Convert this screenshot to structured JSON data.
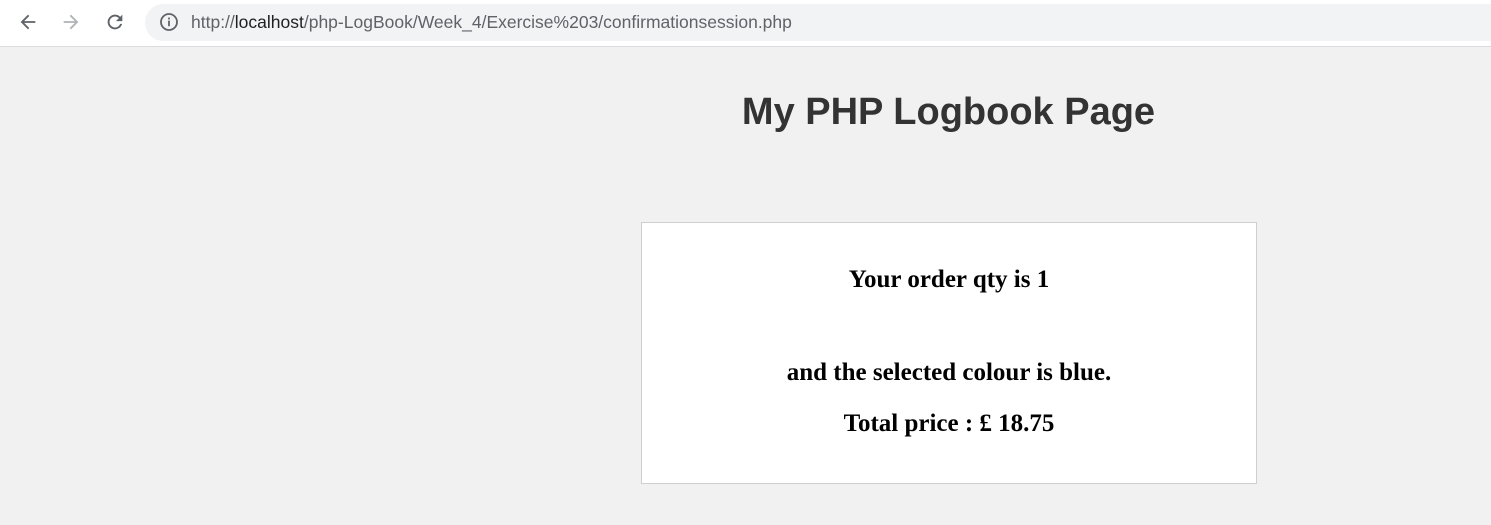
{
  "browser": {
    "url_scheme": "http://",
    "url_host": "localhost",
    "url_path": "/php-LogBook/Week_4/Exercise%203/confirmationsession.php",
    "icons": {
      "back": "arrow-left-icon",
      "forward": "arrow-right-icon",
      "reload": "reload-icon",
      "site_info": "info-icon"
    }
  },
  "page": {
    "title": "My PHP Logbook Page",
    "order": {
      "qty_line": "Your order qty is 1",
      "colour_line": "and the selected colour is blue.",
      "price_line": "Total price : £ 18.75"
    }
  },
  "colors": {
    "page_background": "#f1f1f1",
    "title_text": "#333333",
    "card_background": "#ffffff",
    "card_border": "#cfcfcf"
  }
}
